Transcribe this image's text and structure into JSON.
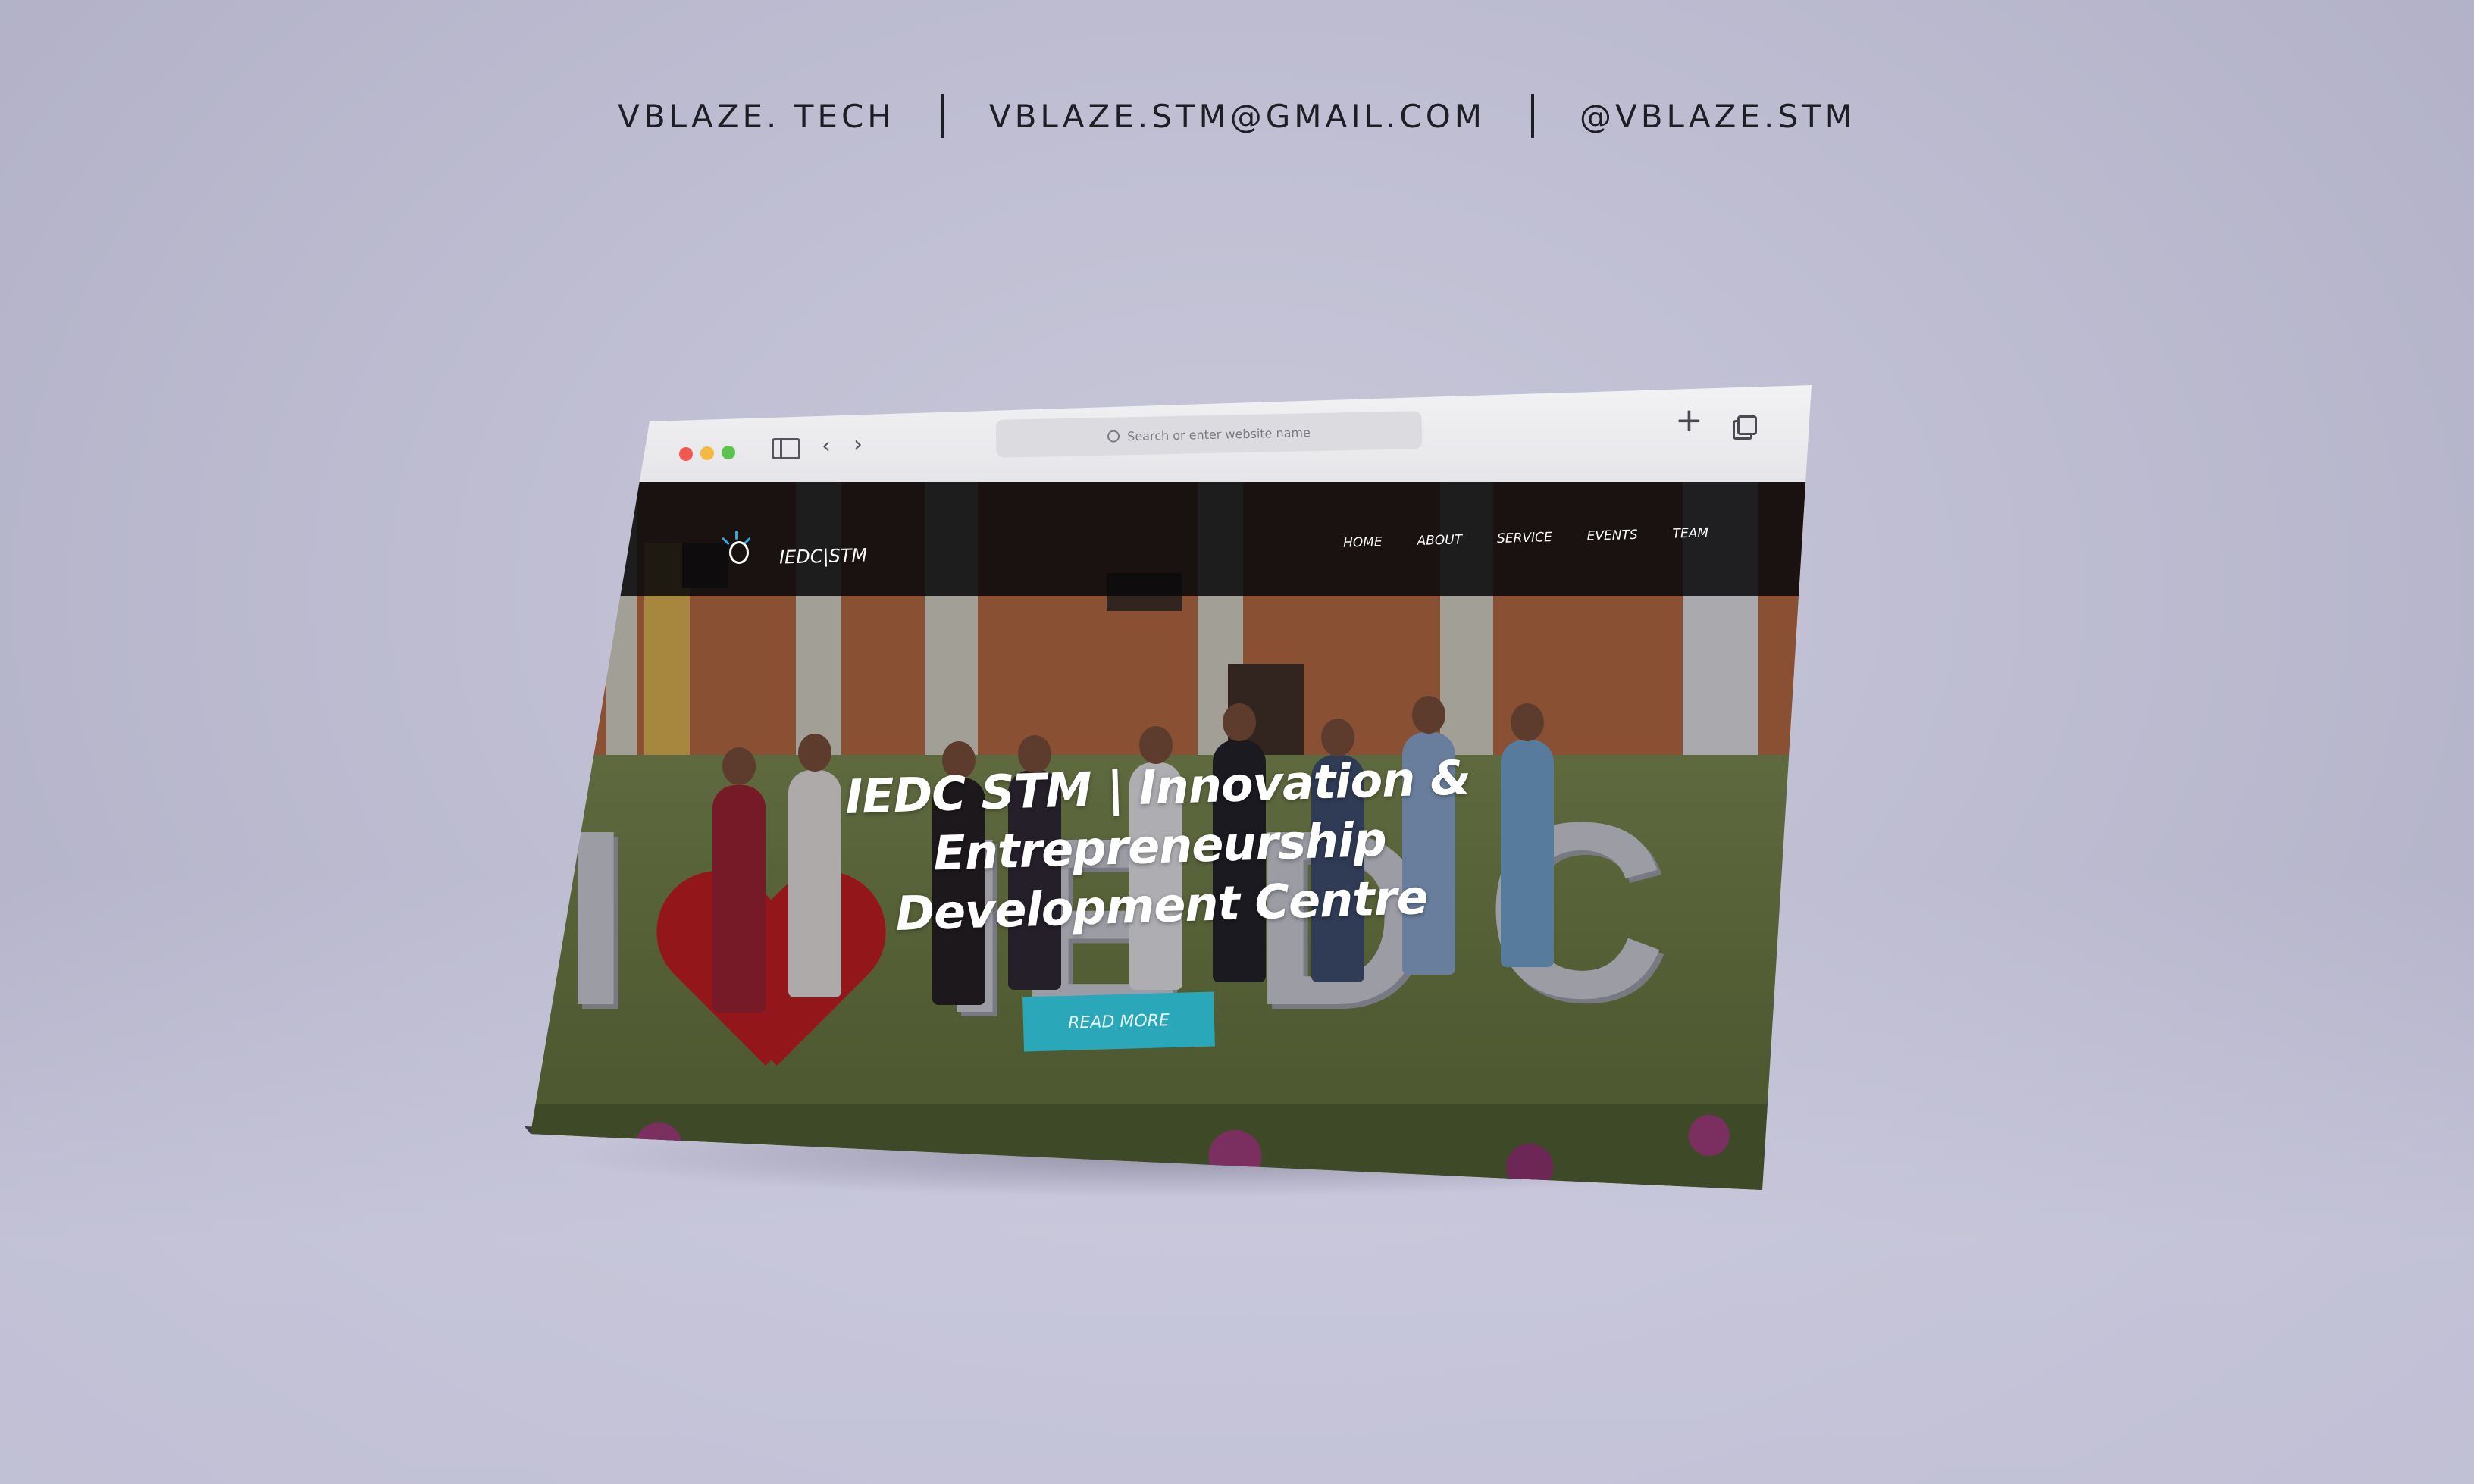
{
  "header": {
    "website": "VBLAZE. TECH",
    "email": "VBLAZE.STM@GMAIL.COM",
    "handle": "@VBLAZE.STM"
  },
  "browser": {
    "address_placeholder": "Search or enter website name",
    "icons": {
      "sidebar": "sidebar-icon",
      "back": "chevron-left-icon",
      "forward": "chevron-right-icon",
      "new_tab": "plus-icon",
      "tabs": "tabs-overview-icon"
    }
  },
  "site": {
    "logo_text": "IEDC|STM",
    "nav": [
      "HOME",
      "ABOUT",
      "SERVICE",
      "EVENTS",
      "TEAM"
    ],
    "hero_title": "IEDC STM | Innovation & Entrepreneurship Development Centre",
    "cta_label": "READ MORE",
    "colors": {
      "cta": "#2aa7b8",
      "navbar": "#08080a",
      "logo_accent": "#35a7d6"
    }
  }
}
